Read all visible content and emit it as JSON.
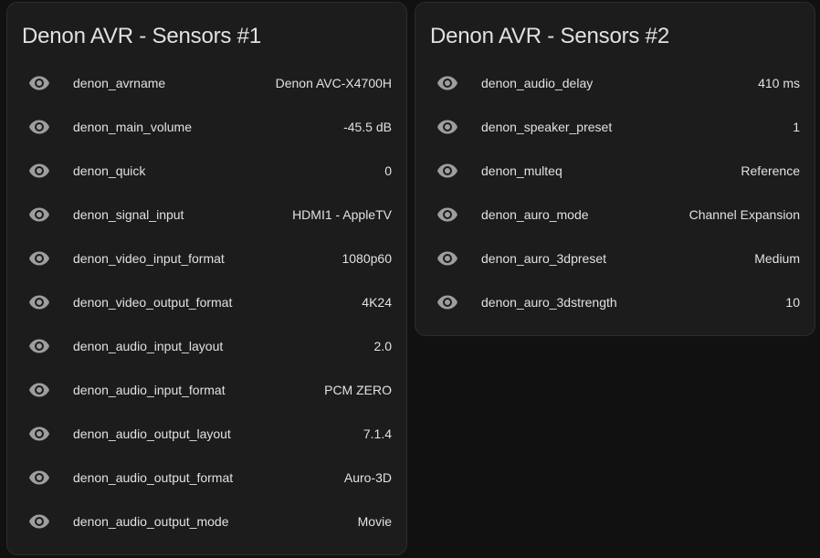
{
  "cards": [
    {
      "title": "Denon AVR - Sensors #1",
      "rows": [
        {
          "icon": "eye-icon",
          "name": "denon_avrname",
          "value": "Denon AVC-X4700H"
        },
        {
          "icon": "eye-icon",
          "name": "denon_main_volume",
          "value": "-45.5 dB"
        },
        {
          "icon": "eye-icon",
          "name": "denon_quick",
          "value": "0"
        },
        {
          "icon": "eye-icon",
          "name": "denon_signal_input",
          "value": "HDMI1 - AppleTV"
        },
        {
          "icon": "eye-icon",
          "name": "denon_video_input_format",
          "value": "1080p60"
        },
        {
          "icon": "eye-icon",
          "name": "denon_video_output_format",
          "value": "4K24"
        },
        {
          "icon": "eye-icon",
          "name": "denon_audio_input_layout",
          "value": "2.0"
        },
        {
          "icon": "eye-icon",
          "name": "denon_audio_input_format",
          "value": "PCM ZERO"
        },
        {
          "icon": "eye-icon",
          "name": "denon_audio_output_layout",
          "value": "7.1.4"
        },
        {
          "icon": "eye-icon",
          "name": "denon_audio_output_format",
          "value": "Auro-3D"
        },
        {
          "icon": "eye-icon",
          "name": "denon_audio_output_mode",
          "value": "Movie"
        }
      ]
    },
    {
      "title": "Denon AVR - Sensors #2",
      "rows": [
        {
          "icon": "eye-icon",
          "name": "denon_audio_delay",
          "value": "410 ms"
        },
        {
          "icon": "eye-icon",
          "name": "denon_speaker_preset",
          "value": "1"
        },
        {
          "icon": "eye-icon",
          "name": "denon_multeq",
          "value": "Reference"
        },
        {
          "icon": "eye-icon",
          "name": "denon_auro_mode",
          "value": "Channel Expansion"
        },
        {
          "icon": "eye-icon",
          "name": "denon_auro_3dpreset",
          "value": "Medium"
        },
        {
          "icon": "eye-icon",
          "name": "denon_auro_3dstrength",
          "value": "10"
        }
      ]
    }
  ],
  "colors": {
    "background": "#111111",
    "card": "#1c1c1c",
    "text": "#e1e1e1",
    "icon": "#9e9e9e"
  }
}
